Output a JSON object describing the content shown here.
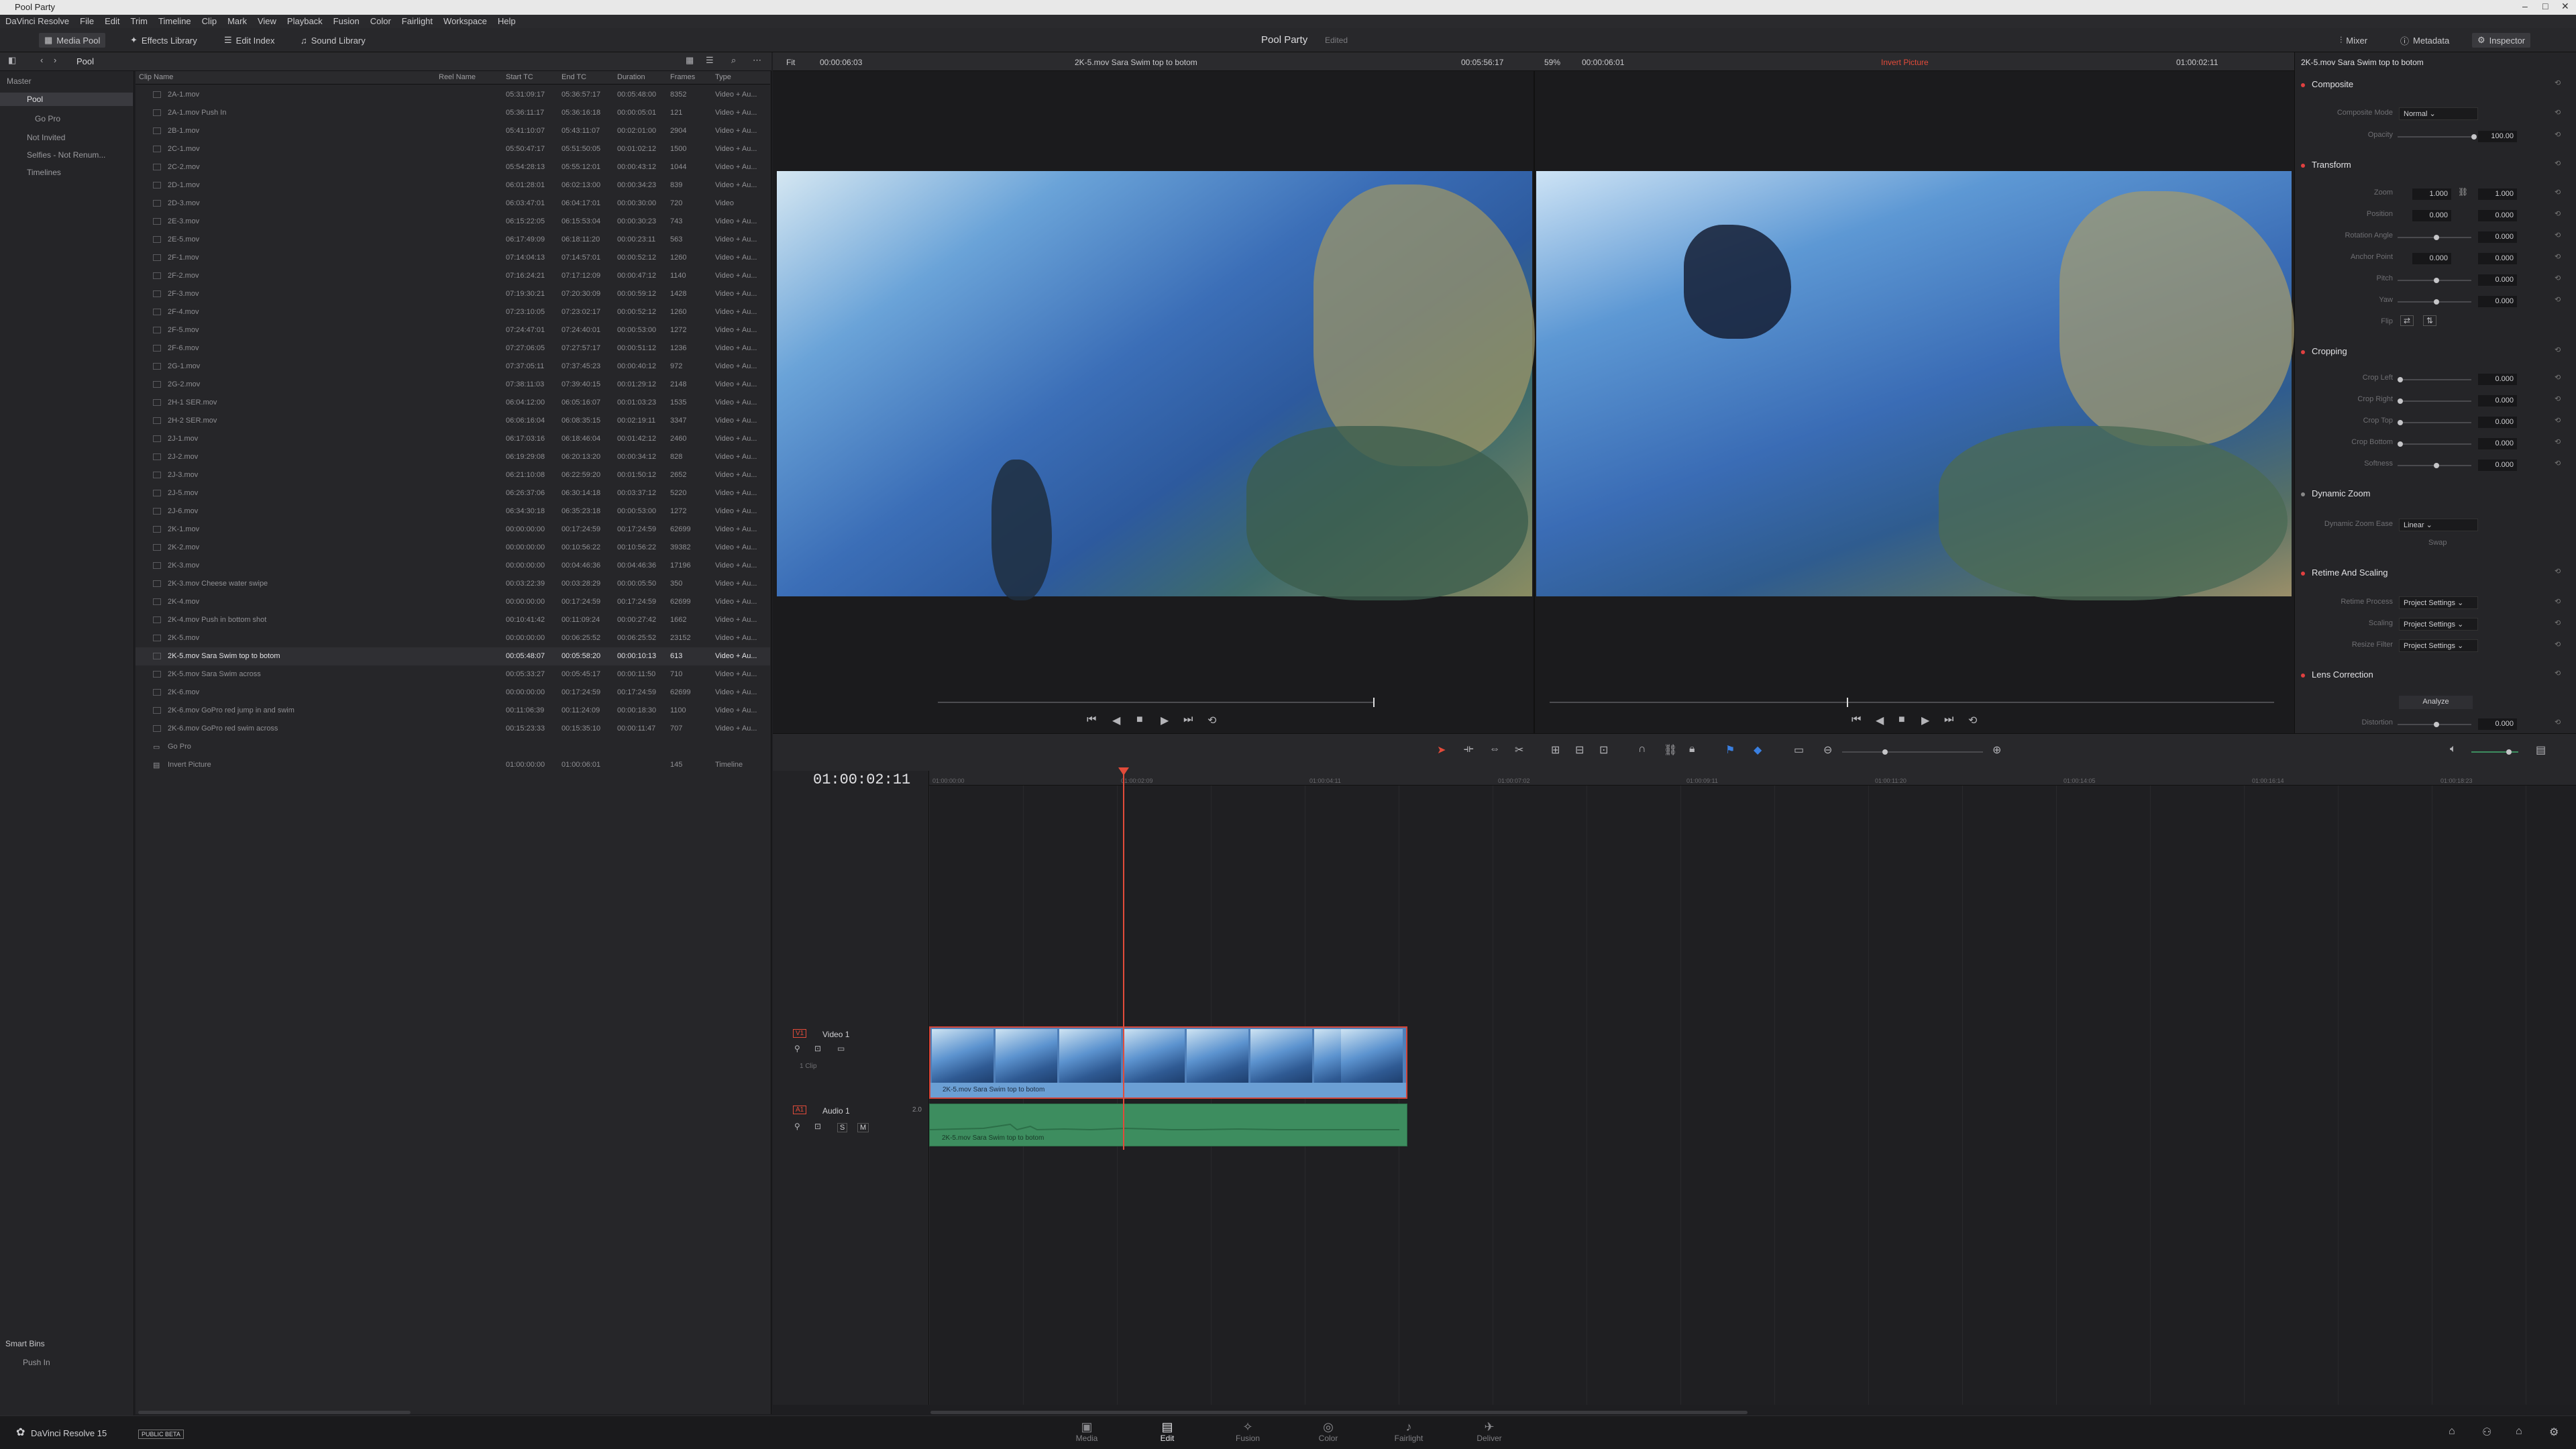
{
  "window": {
    "title": "Pool Party"
  },
  "menu": [
    "DaVinci Resolve",
    "File",
    "Edit",
    "Trim",
    "Timeline",
    "Clip",
    "Mark",
    "View",
    "Playback",
    "Fusion",
    "Color",
    "Fairlight",
    "Workspace",
    "Help"
  ],
  "toolbar": {
    "media_pool": "Media Pool",
    "effects_library": "Effects Library",
    "edit_index": "Edit Index",
    "sound_library": "Sound Library",
    "project_title": "Pool Party",
    "project_status": "Edited",
    "mixer": "Mixer",
    "metadata": "Metadata",
    "inspector": "Inspector"
  },
  "bins": {
    "master": "Master",
    "pool": "Pool",
    "gopro": "Go Pro",
    "not_invited": "Not Invited",
    "selfies": "Selfies - Not Renum...",
    "timelines": "Timelines",
    "smart_bins": "Smart Bins",
    "push_in": "Push In"
  },
  "pool_header": {
    "name": "Pool"
  },
  "columns": [
    "Clip Name",
    "Reel Name",
    "Start TC",
    "End TC",
    "Duration",
    "Frames",
    "Type"
  ],
  "clips": [
    [
      "2A-1.mov",
      "05:31:09:17",
      "05:36:57:17",
      "00:05:48:00",
      "8352",
      "Video + Au..."
    ],
    [
      "2A-1.mov Push In",
      "05:36:11:17",
      "05:36:16:18",
      "00:00:05:01",
      "121",
      "Video + Au..."
    ],
    [
      "2B-1.mov",
      "05:41:10:07",
      "05:43:11:07",
      "00:02:01:00",
      "2904",
      "Video + Au..."
    ],
    [
      "2C-1.mov",
      "05:50:47:17",
      "05:51:50:05",
      "00:01:02:12",
      "1500",
      "Video + Au..."
    ],
    [
      "2C-2.mov",
      "05:54:28:13",
      "05:55:12:01",
      "00:00:43:12",
      "1044",
      "Video + Au..."
    ],
    [
      "2D-1.mov",
      "06:01:28:01",
      "06:02:13:00",
      "00:00:34:23",
      "839",
      "Video + Au..."
    ],
    [
      "2D-3.mov",
      "06:03:47:01",
      "06:04:17:01",
      "00:00:30:00",
      "720",
      "Video"
    ],
    [
      "2E-3.mov",
      "06:15:22:05",
      "06:15:53:04",
      "00:00:30:23",
      "743",
      "Video + Au..."
    ],
    [
      "2E-5.mov",
      "06:17:49:09",
      "06:18:11:20",
      "00:00:23:11",
      "563",
      "Video + Au..."
    ],
    [
      "2F-1.mov",
      "07:14:04:13",
      "07:14:57:01",
      "00:00:52:12",
      "1260",
      "Video + Au..."
    ],
    [
      "2F-2.mov",
      "07:16:24:21",
      "07:17:12:09",
      "00:00:47:12",
      "1140",
      "Video + Au..."
    ],
    [
      "2F-3.mov",
      "07:19:30:21",
      "07:20:30:09",
      "00:00:59:12",
      "1428",
      "Video + Au..."
    ],
    [
      "2F-4.mov",
      "07:23:10:05",
      "07:23:02:17",
      "00:00:52:12",
      "1260",
      "Video + Au..."
    ],
    [
      "2F-5.mov",
      "07:24:47:01",
      "07:24:40:01",
      "00:00:53:00",
      "1272",
      "Video + Au..."
    ],
    [
      "2F-6.mov",
      "07:27:06:05",
      "07:27:57:17",
      "00:00:51:12",
      "1236",
      "Video + Au..."
    ],
    [
      "2G-1.mov",
      "07:37:05:11",
      "07:37:45:23",
      "00:00:40:12",
      "972",
      "Video + Au..."
    ],
    [
      "2G-2.mov",
      "07:38:11:03",
      "07:39:40:15",
      "00:01:29:12",
      "2148",
      "Video + Au..."
    ],
    [
      "2H-1 SER.mov",
      "06:04:12:00",
      "06:05:16:07",
      "00:01:03:23",
      "1535",
      "Video + Au..."
    ],
    [
      "2H-2 SER.mov",
      "06:06:16:04",
      "06:08:35:15",
      "00:02:19:11",
      "3347",
      "Video + Au..."
    ],
    [
      "2J-1.mov",
      "06:17:03:16",
      "06:18:46:04",
      "00:01:42:12",
      "2460",
      "Video + Au..."
    ],
    [
      "2J-2.mov",
      "06:19:29:08",
      "06:20:13:20",
      "00:00:34:12",
      "828",
      "Video + Au..."
    ],
    [
      "2J-3.mov",
      "06:21:10:08",
      "06:22:59:20",
      "00:01:50:12",
      "2652",
      "Video + Au..."
    ],
    [
      "2J-5.mov",
      "06:26:37:06",
      "06:30:14:18",
      "00:03:37:12",
      "5220",
      "Video + Au..."
    ],
    [
      "2J-6.mov",
      "06:34:30:18",
      "06:35:23:18",
      "00:00:53:00",
      "1272",
      "Video + Au..."
    ],
    [
      "2K-1.mov",
      "00:00:00:00",
      "00:17:24:59",
      "00:17:24:59",
      "62699",
      "Video + Au..."
    ],
    [
      "2K-2.mov",
      "00:00:00:00",
      "00:10:56:22",
      "00:10:56:22",
      "39382",
      "Video + Au..."
    ],
    [
      "2K-3.mov",
      "00:00:00:00",
      "00:04:46:36",
      "00:04:46:36",
      "17196",
      "Video + Au..."
    ],
    [
      "2K-3.mov Cheese water swipe",
      "00:03:22:39",
      "00:03:28:29",
      "00:00:05:50",
      "350",
      "Video + Au..."
    ],
    [
      "2K-4.mov",
      "00:00:00:00",
      "00:17:24:59",
      "00:17:24:59",
      "62699",
      "Video + Au..."
    ],
    [
      "2K-4.mov Push in bottom shot",
      "00:10:41:42",
      "00:11:09:24",
      "00:00:27:42",
      "1662",
      "Video + Au..."
    ],
    [
      "2K-5.mov",
      "00:00:00:00",
      "00:06:25:52",
      "00:06:25:52",
      "23152",
      "Video + Au..."
    ],
    [
      "2K-5.mov Sara Swim  top to botom",
      "00:05:48:07",
      "00:05:58:20",
      "00:00:10:13",
      "613",
      "Video + Au..."
    ],
    [
      "2K-5.mov Sara Swim across",
      "00:05:33:27",
      "00:05:45:17",
      "00:00:11:50",
      "710",
      "Video + Au..."
    ],
    [
      "2K-6.mov",
      "00:00:00:00",
      "00:17:24:59",
      "00:17:24:59",
      "62699",
      "Video + Au..."
    ],
    [
      "2K-6.mov GoPro red jump in and swim",
      "00:11:06:39",
      "00:11:24:09",
      "00:00:18:30",
      "1100",
      "Video + Au..."
    ],
    [
      "2K-6.mov GoPro red swim across",
      "00:15:23:33",
      "00:15:35:10",
      "00:00:11:47",
      "707",
      "Video + Au..."
    ]
  ],
  "pool_folders": [
    {
      "name": "Go Pro"
    },
    {
      "name": "Invert Picture",
      "start": "01:00:00:00",
      "end": "01:00:06:01",
      "frames": "145",
      "type": "Timeline"
    }
  ],
  "viewer": {
    "fit": "Fit",
    "src_tc": "00:00:06:03",
    "src_clip": "2K-5.mov Sara Swim  top to botom",
    "src_dur": "00:05:56:17",
    "zoom": "59%",
    "prg_tc": "00:00:06:01",
    "prg_name": "Invert Picture",
    "prg_pos": "01:00:02:11"
  },
  "inspector": {
    "clip": "2K-5.mov Sara Swim  top to botom",
    "composite": "Composite",
    "composite_mode_label": "Composite Mode",
    "composite_mode": "Normal",
    "opacity_label": "Opacity",
    "opacity": "100.00",
    "transform": "Transform",
    "zoom_label": "Zoom",
    "zoom_x": "1.000",
    "zoom_y": "1.000",
    "position_label": "Position",
    "pos_x": "0.000",
    "pos_y": "0.000",
    "rotation_label": "Rotation Angle",
    "rotation": "0.000",
    "anchor_label": "Anchor Point",
    "anchor_x": "0.000",
    "anchor_y": "0.000",
    "pitch_label": "Pitch",
    "pitch": "0.000",
    "yaw_label": "Yaw",
    "yaw": "0.000",
    "flip_label": "Flip",
    "cropping": "Cropping",
    "crop_left_label": "Crop Left",
    "crop_left": "0.000",
    "crop_right_label": "Crop Right",
    "crop_right": "0.000",
    "crop_top_label": "Crop Top",
    "crop_top": "0.000",
    "crop_bottom_label": "Crop Bottom",
    "crop_bottom": "0.000",
    "softness_label": "Softness",
    "softness": "0.000",
    "dynamic_zoom": "Dynamic Zoom",
    "dz_ease_label": "Dynamic Zoom Ease",
    "dz_ease": "Linear",
    "dz_swap": "Swap",
    "retime": "Retime And Scaling",
    "retime_process_label": "Retime Process",
    "retime_process": "Project Settings",
    "scaling_label": "Scaling",
    "scaling": "Project Settings",
    "resize_label": "Resize Filter",
    "resize": "Project Settings",
    "lens": "Lens Correction",
    "analyze": "Analyze",
    "distortion_label": "Distortion",
    "distortion": "0.000"
  },
  "timeline": {
    "timecode": "01:00:02:11",
    "ticks": [
      "01:00:00:00",
      "01:00:02:09",
      "01:00:04:11",
      "01:00:07:02",
      "01:00:09:11",
      "01:00:11:20",
      "01:00:14:05",
      "01:00:16:14",
      "01:00:18:23"
    ],
    "video_badge": "V1",
    "video_track": "Video 1",
    "video_count": "1 Clip",
    "audio_badge": "A1",
    "audio_track": "Audio 1",
    "audio_ch": "2.0",
    "clip_name": "2K-5.mov Sara Swim  top to botom",
    "solo": "S",
    "mute": "M"
  },
  "footer": {
    "app": "DaVinci Resolve 15",
    "beta": "PUBLIC BETA"
  },
  "pages": [
    "Media",
    "Edit",
    "Fusion",
    "Color",
    "Fairlight",
    "Deliver"
  ],
  "colors": {
    "accent_red": "#e24b3a",
    "video_clip": "#4f7fb8",
    "audio_clip": "#3d8d5f"
  }
}
